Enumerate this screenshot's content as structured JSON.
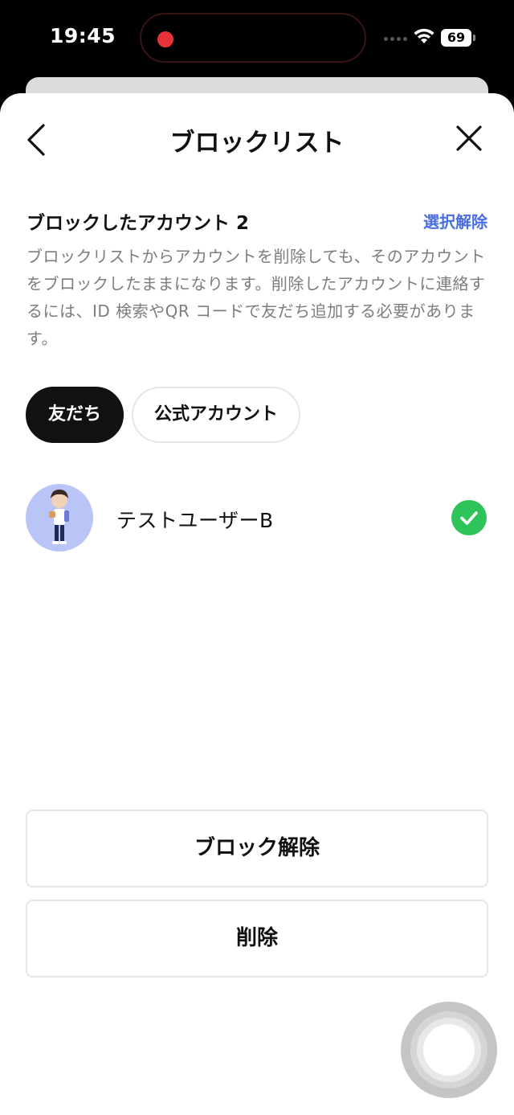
{
  "status_bar": {
    "time": "19:45",
    "battery": "69",
    "recording_color": "#e8323a"
  },
  "header": {
    "title": "ブロックリスト",
    "back_icon": "chevron-left-icon",
    "close_icon": "close-icon"
  },
  "section": {
    "title": "ブロックしたアカウント 2",
    "unselect_label": "選択解除",
    "description": "ブロックリストからアカウントを削除しても、そのアカウントをブロックしたままになります。削除したアカウントに連絡するには、ID 検索やQR コードで友だち追加する必要があります。"
  },
  "tabs": [
    {
      "label": "友だち",
      "active": true
    },
    {
      "label": "公式アカウント",
      "active": false
    }
  ],
  "users": [
    {
      "name": "テストユーザーB",
      "selected": true
    }
  ],
  "actions": {
    "unblock_label": "ブロック解除",
    "delete_label": "削除"
  },
  "colors": {
    "accent_link": "#4a6ee0",
    "check_green": "#2ec45a",
    "avatar_bg": "#b9c4f7"
  }
}
